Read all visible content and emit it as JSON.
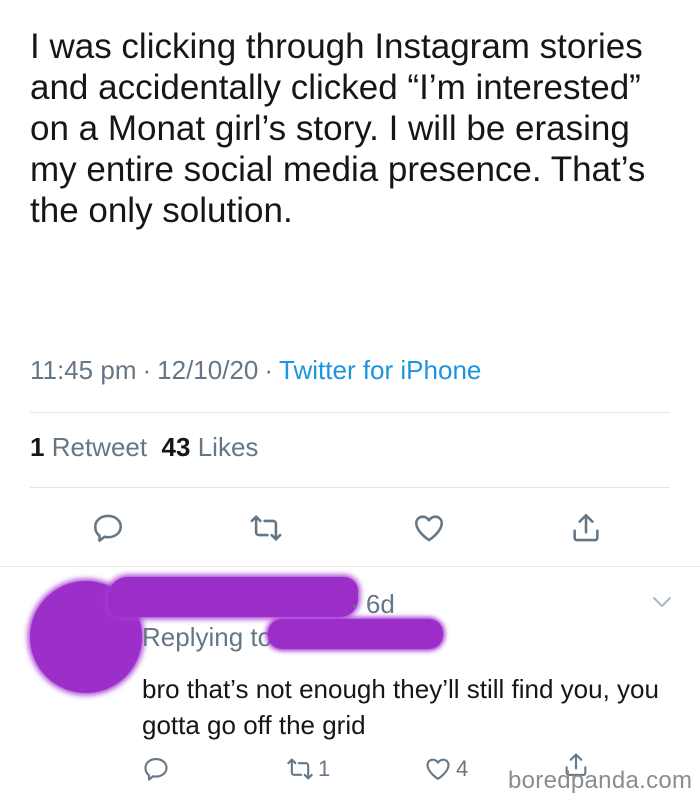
{
  "tweet": {
    "text": "I was clicking through Instagram stories and accidentally clicked “I’m interested” on a Monat girl’s story. I will be erasing my entire social media presence. That’s the only solution.",
    "time": "11:45 pm",
    "date": "12/10/20",
    "source": "Twitter for iPhone",
    "separator": "·",
    "retweets_count": "1",
    "retweets_label": "Retweet",
    "likes_count": "43",
    "likes_label": "Likes"
  },
  "actions": {
    "reply_icon": "reply-icon",
    "retweet_icon": "retweet-icon",
    "like_icon": "heart-icon",
    "share_icon": "share-icon"
  },
  "reply": {
    "time": "· 6d",
    "replying_prefix": "Replying to",
    "text": "bro that’s not enough they’ll still find you, you gotta go off the grid",
    "retweet_count": "1",
    "like_count": "4"
  },
  "watermark": "boredpanda.com",
  "colors": {
    "text": "#14171a",
    "secondary": "#657786",
    "link": "#1b95e0",
    "icon": "#657786",
    "redaction": "#9b2ec8"
  }
}
